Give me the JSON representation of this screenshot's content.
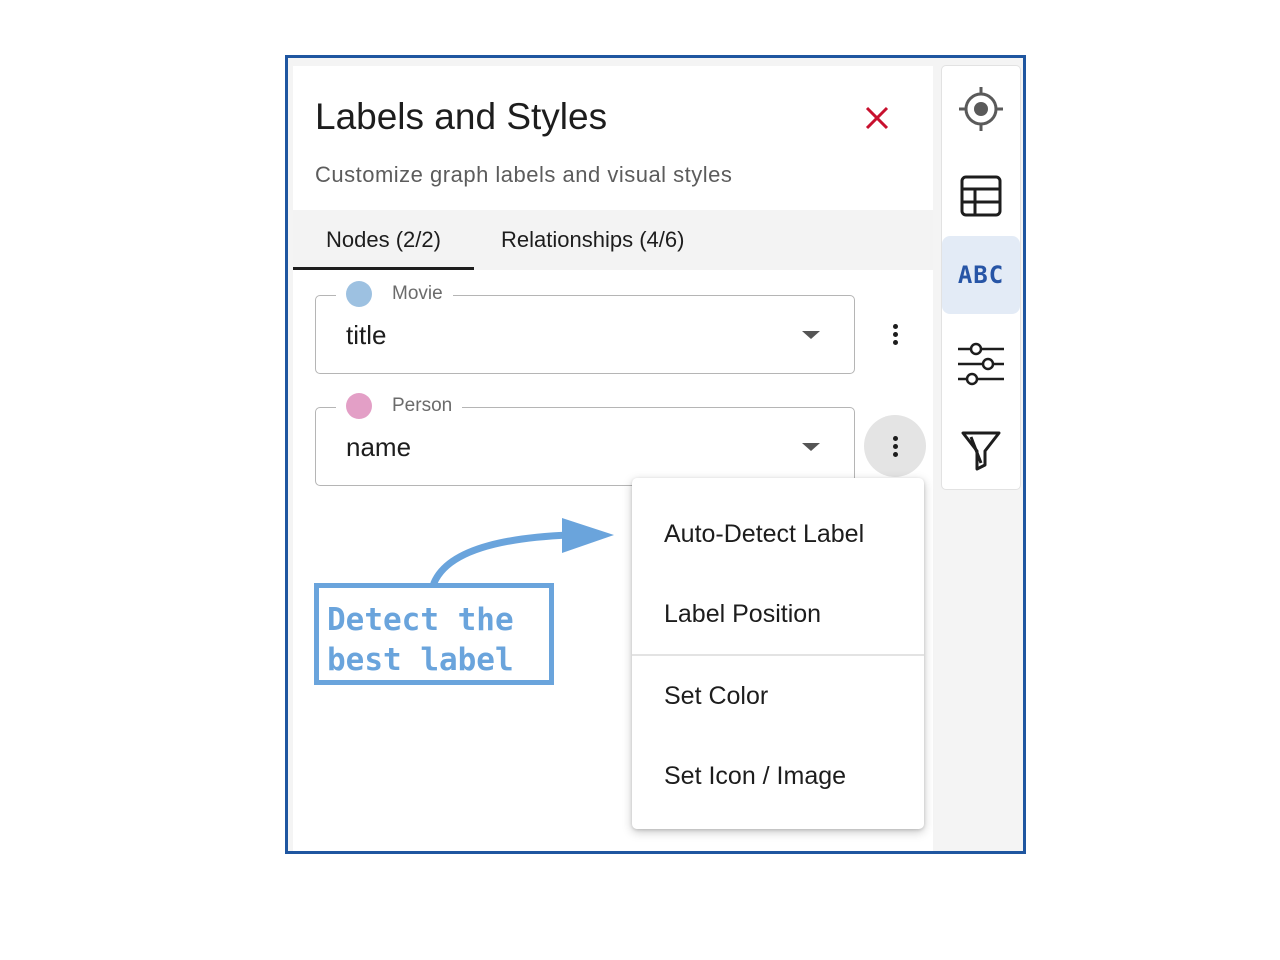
{
  "panel": {
    "title": "Labels and Styles",
    "subtitle": "Customize graph labels and visual styles"
  },
  "tabs": [
    {
      "label": "Nodes (2/2)",
      "selected": true
    },
    {
      "label": "Relationships (4/6)",
      "selected": false
    }
  ],
  "nodes": [
    {
      "category": "Movie",
      "color": "#9dc1e1",
      "property": "title"
    },
    {
      "category": "Person",
      "color": "#e39fc6",
      "property": "name"
    }
  ],
  "menu": {
    "items": [
      "Auto-Detect Label",
      "Label Position",
      "Set Color",
      "Set Icon / Image"
    ]
  },
  "sidebar": {
    "items": [
      {
        "icon": "target-icon"
      },
      {
        "icon": "table-icon"
      },
      {
        "icon": "abc-icon",
        "text": "ABC",
        "active": true
      },
      {
        "icon": "sliders-icon"
      },
      {
        "icon": "filter-icon"
      }
    ]
  },
  "annotation": {
    "text": "Detect the\nbest label",
    "color": "#6aa4dc"
  },
  "colors": {
    "frame_border": "#1f56a0",
    "close": "#c8102e",
    "accent": "#2755a6"
  }
}
